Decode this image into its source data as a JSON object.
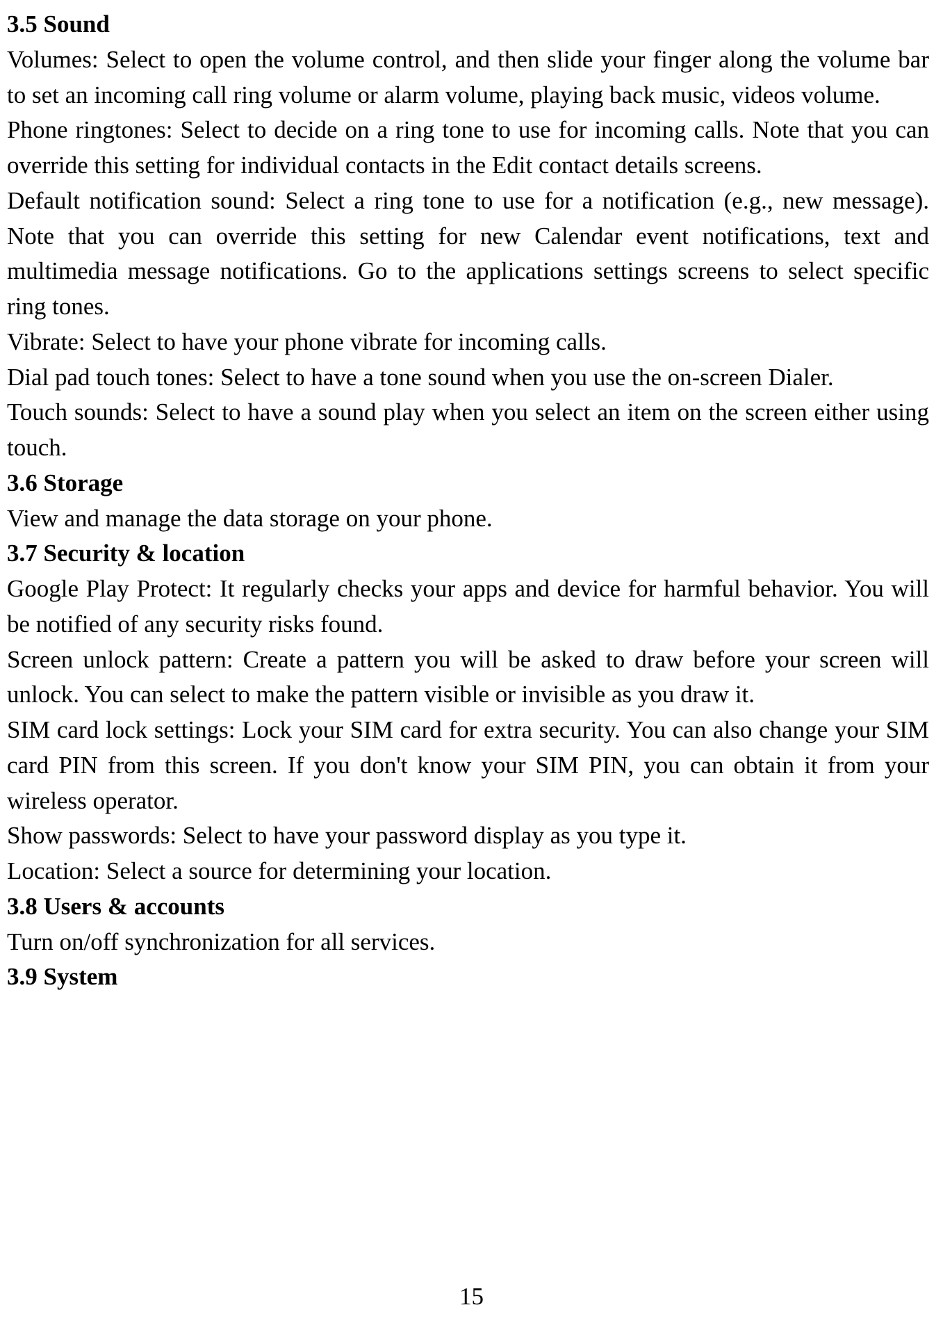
{
  "sections": {
    "sound": {
      "heading": "3.5 Sound",
      "volumes": "Volumes: Select to open the volume control, and then slide your finger along the volume bar to set an incoming call ring volume or alarm volume, playing back music, videos volume.",
      "ringtones": "Phone ringtones: Select to decide on a ring tone to use for incoming calls. Note that you can override this setting for individual contacts in the Edit contact details screens.",
      "notification": "Default notification sound: Select a ring tone to use for a notification (e.g., new message). Note that you can override this setting for new Calendar event notifications, text and multimedia message notifications. Go to the applications settings screens to select specific ring tones.",
      "vibrate": "Vibrate: Select to have your phone vibrate for incoming calls.",
      "dialpad": "Dial pad touch tones: Select to have a tone sound when you use the on-screen Dialer.",
      "touch": "Touch sounds: Select to have a sound play when you select an item on the screen either using touch."
    },
    "storage": {
      "heading": "3.6 Storage",
      "body": "View and manage the data storage on your phone."
    },
    "security": {
      "heading": "3.7 Security & location",
      "playprotect": "Google Play Protect: It regularly checks your apps and device for harmful behavior. You will be notified of any security risks found.",
      "unlock": "Screen unlock pattern: Create a pattern you will be asked to draw before your screen will unlock. You can select to make the pattern visible or invisible as you draw it.",
      "simlock": "SIM card lock settings: Lock your SIM card for extra security. You can also change your SIM card PIN from this screen. If you don't know your SIM PIN, you can obtain it from your wireless operator.",
      "passwords": "Show passwords: Select to have your password display as you type it.",
      "location": "Location: Select a source for determining your location."
    },
    "users": {
      "heading": "3.8 Users & accounts",
      "body": "Turn on/off synchronization for all services."
    },
    "system": {
      "heading": "3.9 System"
    }
  },
  "page_number": "15"
}
